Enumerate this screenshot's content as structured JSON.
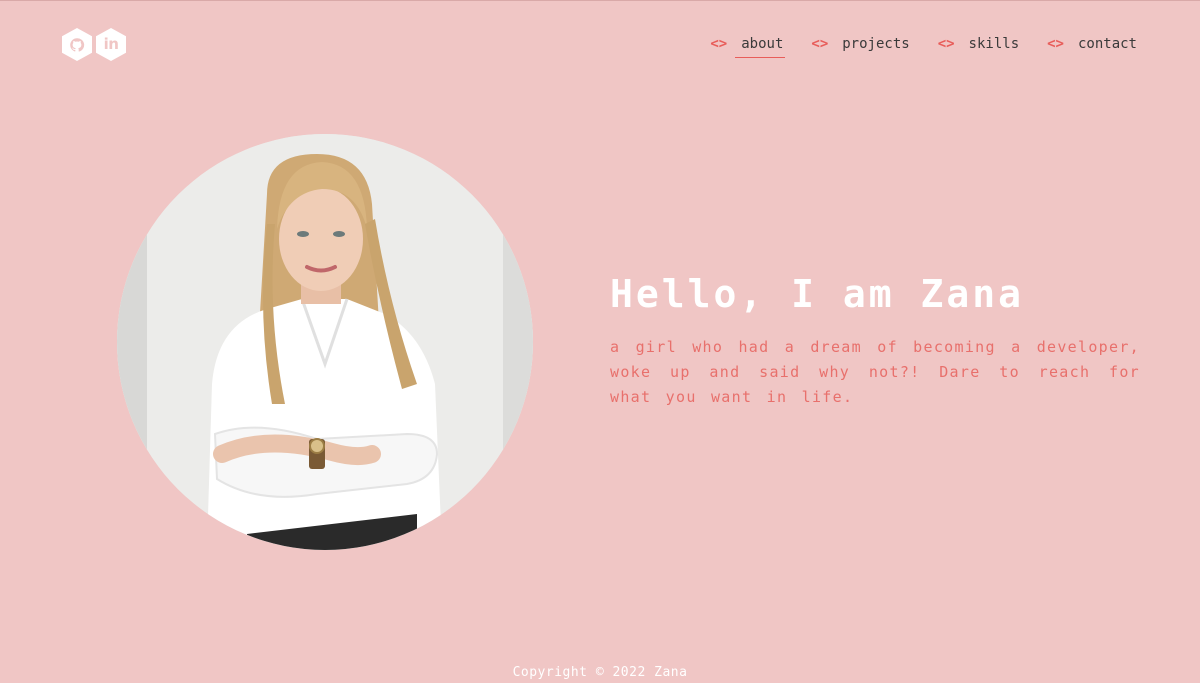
{
  "social": {
    "github_icon": "github-icon",
    "linkedin_icon": "linkedin-icon",
    "linkedin_text": "in"
  },
  "nav": {
    "items": [
      {
        "label": "about",
        "icon": "code-brackets-icon",
        "active": true
      },
      {
        "label": "projects",
        "icon": "code-brackets-icon",
        "active": false
      },
      {
        "label": "skills",
        "icon": "code-brackets-icon",
        "active": false
      },
      {
        "label": "contact",
        "icon": "code-brackets-icon",
        "active": false
      }
    ],
    "bracket_glyph": "<>"
  },
  "hero": {
    "title": "Hello, I am Zana",
    "description": "a girl who had a dream of becoming a developer, woke up and said why not?! Dare to reach for what you want in life."
  },
  "footer": {
    "text": "Copyright © 2022 Zana"
  },
  "colors": {
    "background": "#f0c6c5",
    "accent": "#e85d5a",
    "title": "#ffffff",
    "body_text": "#e8706c"
  }
}
